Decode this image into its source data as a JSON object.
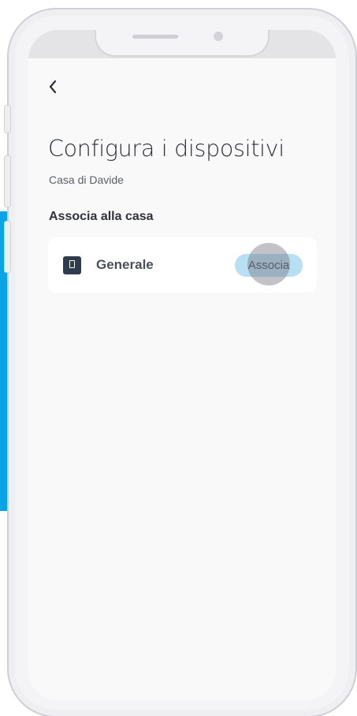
{
  "header": {
    "back_icon": "chevron-left-icon"
  },
  "page": {
    "title": "Configura i dispositivi",
    "subtitle": "Casa di Davide",
    "section_label": "Associa alla casa"
  },
  "devices": [
    {
      "icon": "door-device-icon",
      "name": "Generale",
      "action_label": "Associa"
    }
  ],
  "colors": {
    "accent": "#0aa3e6",
    "button_bg": "#b9dff4",
    "icon_bg": "#2f3b4f",
    "text_primary": "#2c3036"
  }
}
